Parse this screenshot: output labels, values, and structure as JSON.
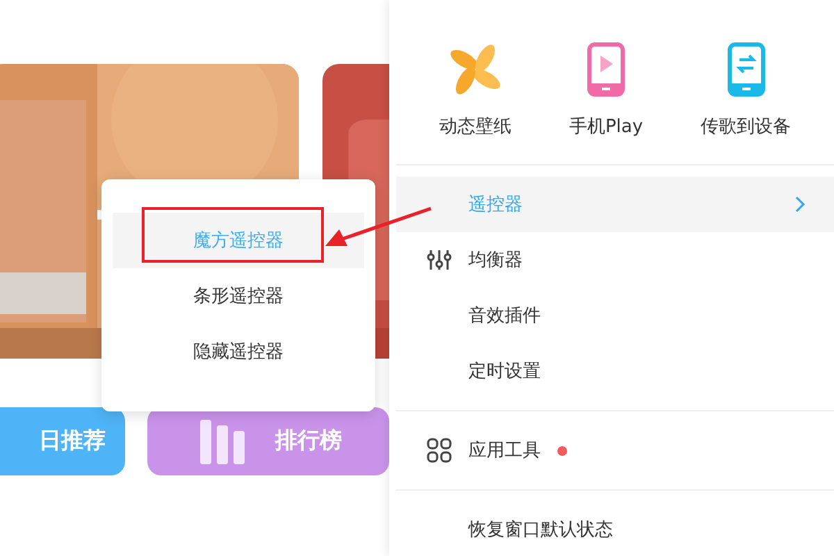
{
  "left_panel": {
    "shortcuts": [
      {
        "label": "日推荐",
        "color": "#4fb3f7"
      },
      {
        "label": "排行榜",
        "color": "#c993ea"
      }
    ]
  },
  "submenu": {
    "items": [
      {
        "label": "魔方遥控器",
        "selected": true
      },
      {
        "label": "条形遥控器",
        "selected": false
      },
      {
        "label": "隐藏遥控器",
        "selected": false
      }
    ]
  },
  "menu": {
    "tools": [
      {
        "label": "动态壁纸",
        "kind": "pinwheel"
      },
      {
        "label": "手机Play",
        "kind": "phone-play"
      },
      {
        "label": "传歌到设备",
        "kind": "phone-transfer"
      }
    ],
    "groups": [
      [
        {
          "label": "遥控器",
          "selected": true,
          "has_submenu": true,
          "kind": "plain"
        },
        {
          "label": "均衡器",
          "selected": false,
          "has_submenu": false,
          "kind": "equalizer"
        },
        {
          "label": "音效插件",
          "selected": false,
          "has_submenu": false,
          "kind": "plain"
        },
        {
          "label": "定时设置",
          "selected": false,
          "has_submenu": false,
          "kind": "plain"
        }
      ],
      [
        {
          "label": "应用工具",
          "selected": false,
          "has_submenu": false,
          "kind": "grid",
          "badge": true
        }
      ],
      [
        {
          "label": "恢复窗口默认状态",
          "selected": false,
          "has_submenu": false,
          "kind": "plain"
        }
      ]
    ]
  }
}
